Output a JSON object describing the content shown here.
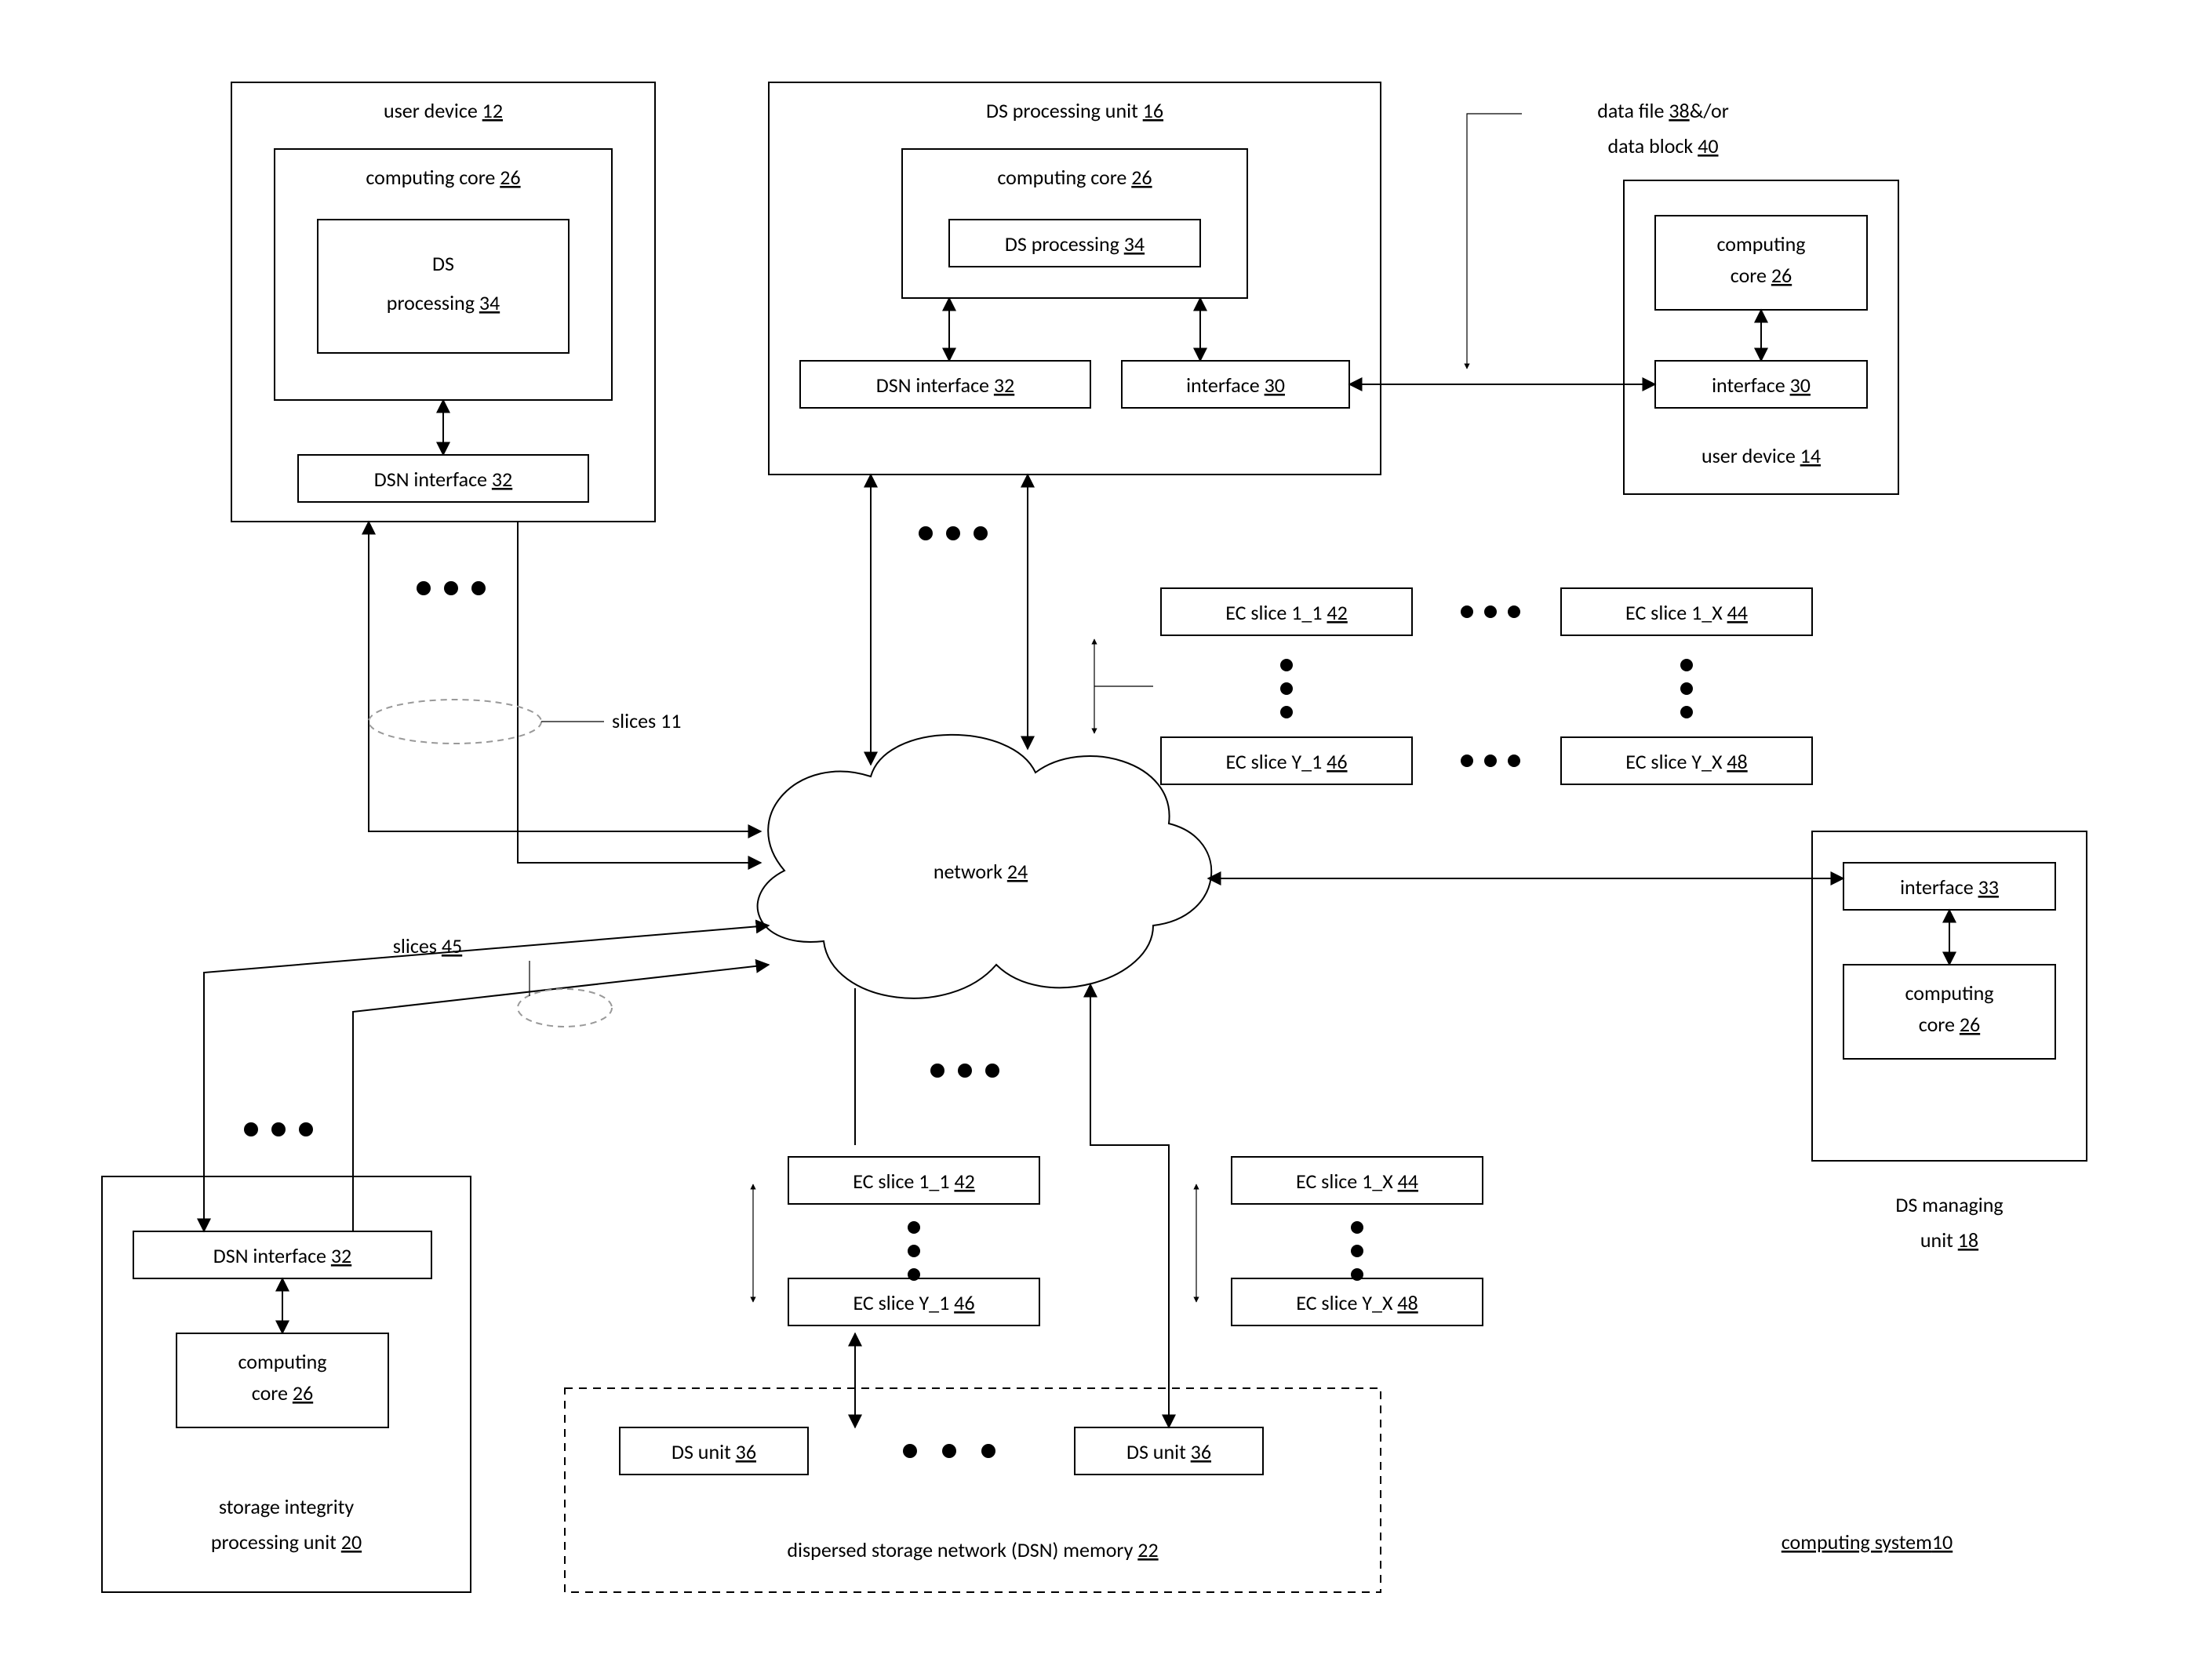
{
  "title_label": "computing system",
  "title_ref": "10",
  "network_label": "network ",
  "network_ref": "24",
  "user_device_12": {
    "title": "user device ",
    "ref": "12",
    "computing_core": "computing core ",
    "cc_ref": "26",
    "ds_proc_line1": "DS",
    "ds_proc_line2": "processing ",
    "dp_ref": "34",
    "dsn_if": "DSN interface ",
    "dsn_ref": "32"
  },
  "ds_processing_unit": {
    "title": "DS processing unit ",
    "ref": "16",
    "computing_core": "computing core ",
    "cc_ref": "26",
    "ds_proc": "DS processing ",
    "dp_ref": "34",
    "dsn_if": "DSN interface ",
    "dsn_ref": "32",
    "if30": "interface ",
    "if30_ref": "30"
  },
  "user_device_14": {
    "title": "user device ",
    "ref": "14",
    "computing_core_l1": "computing",
    "computing_core_l2": "core ",
    "cc_ref": "26",
    "if30": "interface ",
    "if30_ref": "30"
  },
  "datafile_l1": "data file ",
  "datafile_ref1": "38",
  "datafile_mid": "&/or",
  "datafile_l2": "data block ",
  "datafile_ref2": "40",
  "slices11": "slices 11",
  "slices45_label": "slices ",
  "slices45_ref": "45",
  "ec_top": {
    "s11": "EC slice 1_1 ",
    "r11": "42",
    "s1x": "EC slice 1_X ",
    "r1x": "44",
    "sy1": "EC slice Y_1 ",
    "ry1": "46",
    "syx": "EC slice Y_X ",
    "ryx": "48"
  },
  "ec_bot": {
    "s11": "EC slice 1_1 ",
    "r11": "42",
    "s1x": "EC slice 1_X ",
    "r1x": "44",
    "sy1": "EC slice Y_1 ",
    "ry1": "46",
    "syx": "EC slice Y_X ",
    "ryx": "48"
  },
  "ds_managing": {
    "title_l1": "DS managing",
    "title_l2": "unit ",
    "ref": "18",
    "if33": "interface ",
    "if33_ref": "33",
    "computing_core_l1": "computing",
    "computing_core_l2": "core ",
    "cc_ref": "26"
  },
  "storage_integrity": {
    "title_l1": "storage integrity",
    "title_l2": "processing unit ",
    "ref": "20",
    "dsn_if": "DSN interface ",
    "dsn_ref": "32",
    "computing_core_l1": "computing",
    "computing_core_l2": "core ",
    "cc_ref": "26"
  },
  "dsn_memory": {
    "title": "dispersed storage network (DSN) memory ",
    "ref": "22",
    "ds_unit": "DS unit ",
    "du_ref": "36"
  }
}
